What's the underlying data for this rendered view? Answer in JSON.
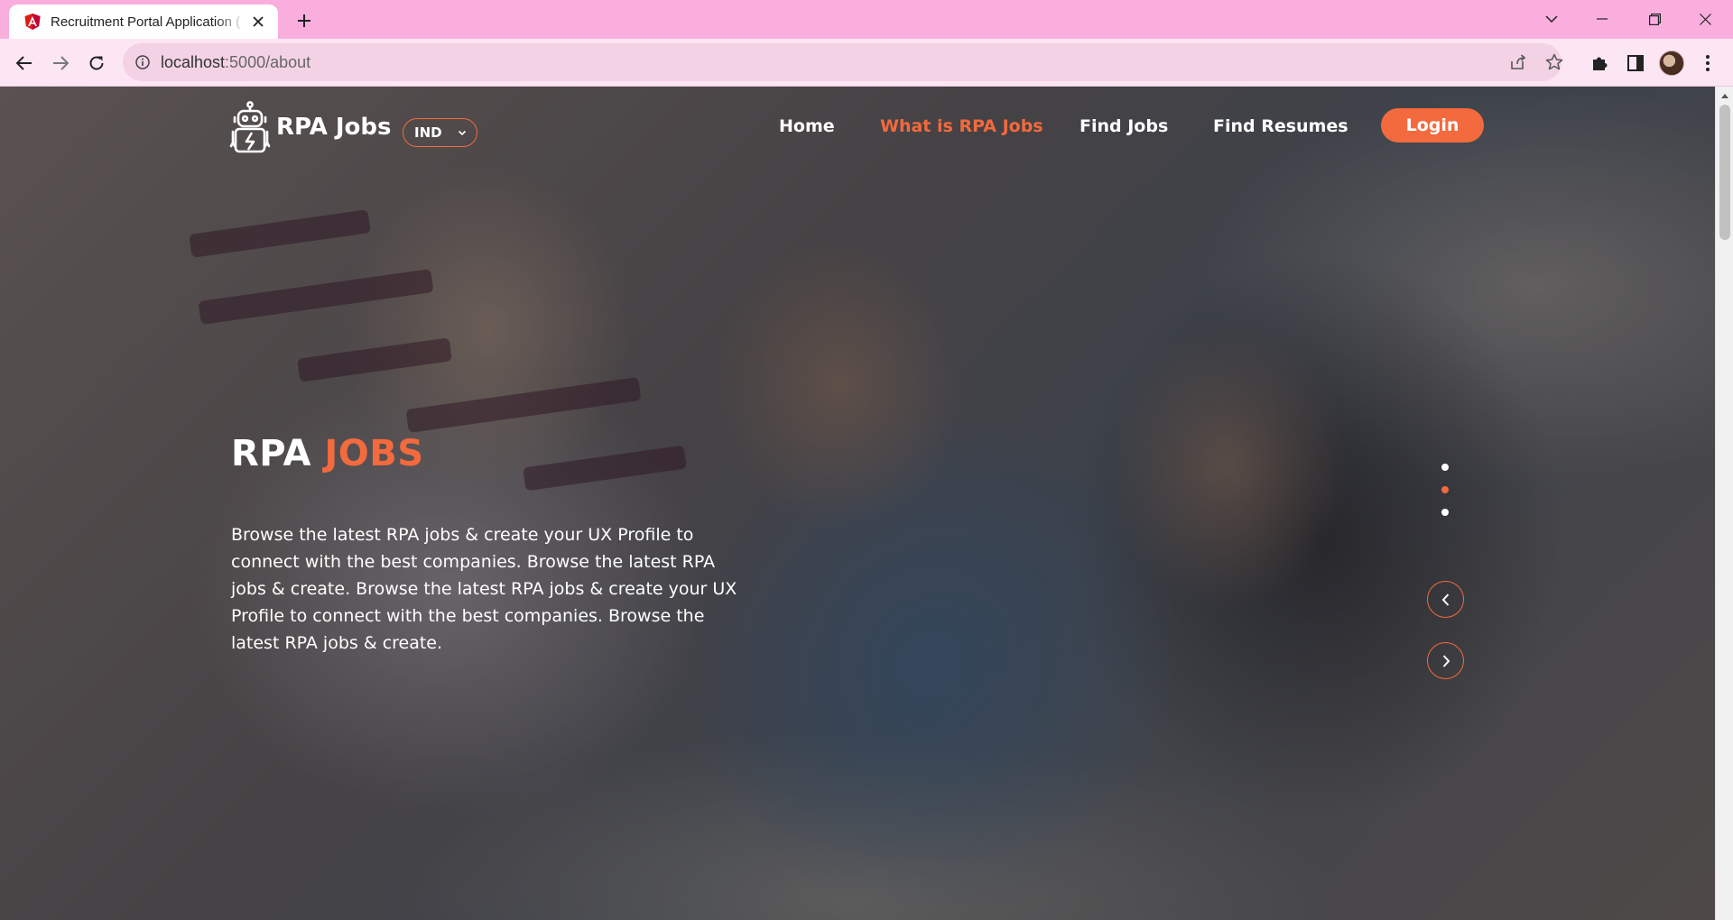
{
  "browser": {
    "tab_title": "Recruitment Portal Application (",
    "url_host": "localhost",
    "url_path": ":5000/about",
    "favicon": "angular-icon",
    "colors": {
      "tabbar": "#f9aede",
      "toolbar": "#fde6f4",
      "omnibox": "#f3d2e6"
    }
  },
  "site": {
    "logo_text": "RPA Jobs",
    "country_selector": "IND",
    "nav": {
      "home": "Home",
      "what_is": "What is RPA Jobs",
      "find_jobs": "Find Jobs",
      "find_resumes": "Find Resumes",
      "login": "Login"
    },
    "active_nav": "What is RPA Jobs"
  },
  "hero": {
    "title_main": "RPA ",
    "title_accent": "JOBS",
    "description": "Browse the latest RPA jobs & create your UX Profile to connect with the best companies. Browse the latest RPA jobs & create. Browse the latest RPA jobs & create your UX Profile to connect with the best companies. Browse the latest RPA jobs & create.",
    "slider": {
      "slides": 3,
      "active_slide": 2
    }
  },
  "colors": {
    "accent": "#f26a3d",
    "text": "#ffffff"
  }
}
